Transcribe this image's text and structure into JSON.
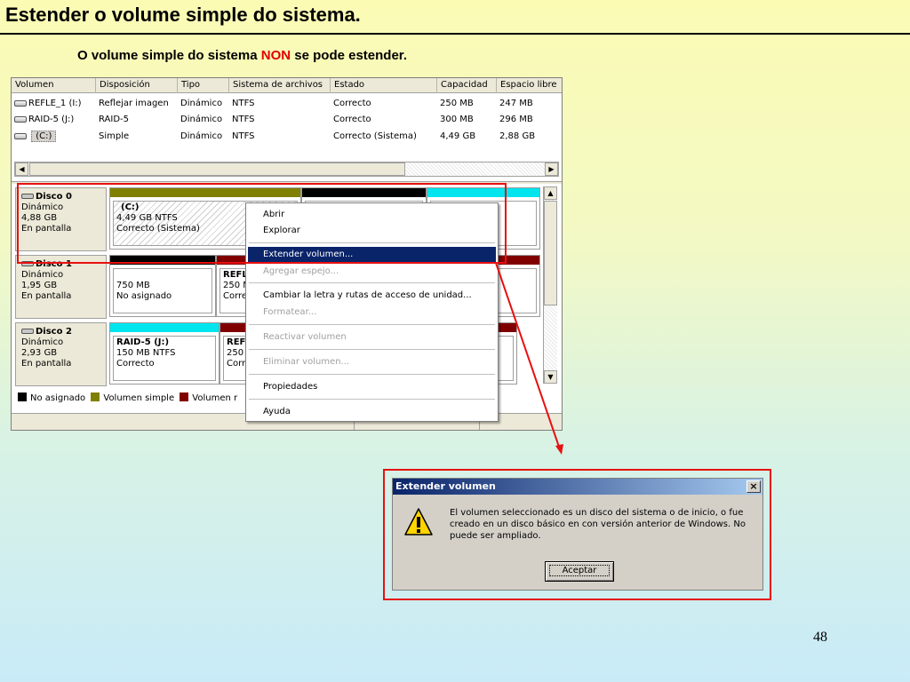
{
  "slide": {
    "title": "Estender o volume simple do sistema.",
    "subtitle_before": "O volume simple do sistema",
    "subtitle_highlight": "NON",
    "subtitle_after": "se pode estender.",
    "page_number": "48"
  },
  "volume_list": {
    "headers": [
      "Volumen",
      "Disposición",
      "Tipo",
      "Sistema de archivos",
      "Estado",
      "Capacidad",
      "Espacio libre"
    ],
    "rows": [
      {
        "volume": "REFLE_1 (I:)",
        "layout": "Reflejar imagen",
        "type": "Dinámico",
        "fs": "NTFS",
        "status": "Correcto",
        "capacity": "250 MB",
        "free": "247 MB"
      },
      {
        "volume": "RAID-5 (J:)",
        "layout": "RAID-5",
        "type": "Dinámico",
        "fs": "NTFS",
        "status": "Correcto",
        "capacity": "300 MB",
        "free": "296 MB"
      },
      {
        "volume": "(C:)",
        "layout": "Simple",
        "type": "Dinámico",
        "fs": "NTFS",
        "status": "Correcto (Sistema)",
        "capacity": "4,49 GB",
        "free": "2,88 GB"
      }
    ]
  },
  "disks": [
    {
      "name": "Disco 0",
      "type": "Dinámico",
      "size": "4,88 GB",
      "state": "En pantalla",
      "partitions": [
        {
          "name": "(C:)",
          "detail": "4,49 GB NTFS",
          "status": "Correcto (Sistema)"
        }
      ]
    },
    {
      "name": "Disco 1",
      "type": "Dinámico",
      "size": "1,95 GB",
      "state": "En pantalla",
      "partitions": [
        {
          "name": "",
          "detail": "750 MB",
          "status": "No asignado"
        },
        {
          "name": "REFL",
          "detail": "250 M",
          "status": "Corre"
        }
      ]
    },
    {
      "name": "Disco 2",
      "type": "Dinámico",
      "size": "2,93 GB",
      "state": "En pantalla",
      "partitions": [
        {
          "name": "RAID-5  (J:)",
          "detail": "150 MB NTFS",
          "status": "Correcto"
        },
        {
          "name": "REF",
          "detail": "250",
          "status": "Corr"
        }
      ]
    }
  ],
  "legend": {
    "unallocated": "No asignado",
    "simple": "Volumen simple",
    "mirror": "Volumen r"
  },
  "colors": {
    "unallocated": "#000000",
    "simple": "#808000",
    "mirror": "#800000",
    "raid5": "#00e5ee",
    "highlight": "#0a246a",
    "annotation": "#e81010"
  },
  "context_menu": {
    "items": [
      {
        "label": "Abrir",
        "enabled": true
      },
      {
        "label": "Explorar",
        "enabled": true
      },
      {
        "label": "Extender volumen...",
        "enabled": true,
        "highlighted": true
      },
      {
        "label": "Agregar espejo...",
        "enabled": false
      },
      {
        "label": "Cambiar la letra y rutas de acceso de unidad...",
        "enabled": true
      },
      {
        "label": "Formatear...",
        "enabled": false
      },
      {
        "label": "Reactivar volumen",
        "enabled": false
      },
      {
        "label": "Eliminar volumen...",
        "enabled": false
      },
      {
        "label": "Propiedades",
        "enabled": true
      },
      {
        "label": "Ayuda",
        "enabled": true
      }
    ]
  },
  "dialog": {
    "title": "Extender volumen",
    "close_label": "×",
    "icon": "warning-icon",
    "message_line1": "El volumen seleccionado es un disco del sistema o de inicio, o fue",
    "message_line2": "creado en un disco básico en con versión anterior de Windows. No",
    "message_line3": "puede ser ampliado.",
    "ok_label": "Aceptar"
  }
}
